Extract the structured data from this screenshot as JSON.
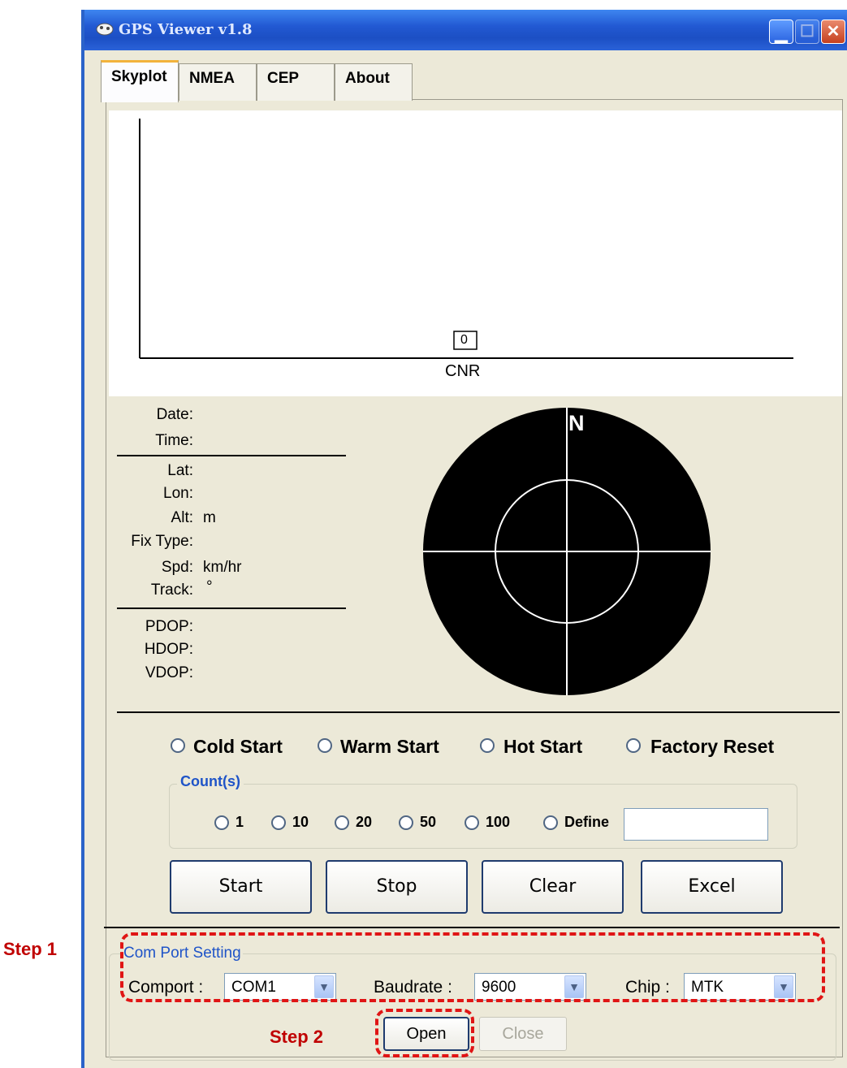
{
  "window": {
    "title": "GPS Viewer v1.8"
  },
  "tabs": [
    "Skyplot",
    "NMEA",
    "CEP",
    "About"
  ],
  "cnr_chart": {
    "bar_label": "0",
    "xlabel": "CNR"
  },
  "info": {
    "date_label": "Date:",
    "time_label": "Time:",
    "lat_label": "Lat:",
    "lon_label": "Lon:",
    "alt_label": "Alt:",
    "alt_unit": "m",
    "fix_label": "Fix Type:",
    "spd_label": "Spd:",
    "spd_unit": "km/hr",
    "track_label": "Track:",
    "track_unit": "°",
    "pdop_label": "PDOP:",
    "hdop_label": "HDOP:",
    "vdop_label": "VDOP:"
  },
  "skyplot": {
    "north_label": "N"
  },
  "start_modes": [
    "Cold Start",
    "Warm Start",
    "Hot Start",
    "Factory Reset"
  ],
  "counts": {
    "title": "Count(s)",
    "options": [
      "1",
      "10",
      "20",
      "50",
      "100",
      "Define"
    ],
    "define_value": ""
  },
  "actions": [
    "Start",
    "Stop",
    "Clear",
    "Excel"
  ],
  "com": {
    "title": "Com Port Setting",
    "comport_label": "Comport :",
    "comport_value": "COM1",
    "baud_label": "Baudrate :",
    "baud_value": "9600",
    "chip_label": "Chip :",
    "chip_value": "MTK",
    "open_label": "Open",
    "close_label": "Close"
  },
  "annotations": {
    "step1": "Step 1",
    "step2": "Step 2"
  },
  "colors": {
    "title_bar": "#2259d3",
    "annotation": "#e01515",
    "group_title": "#1f54c8"
  }
}
